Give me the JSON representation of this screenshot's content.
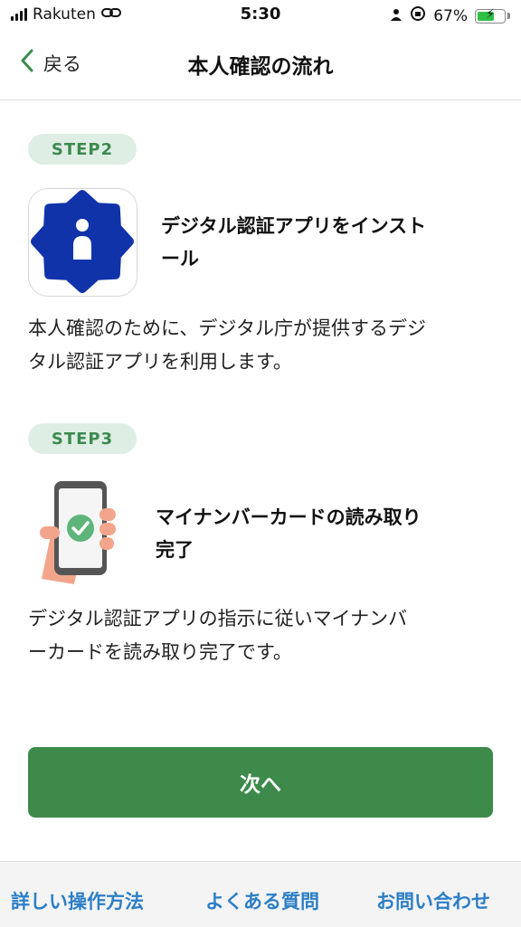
{
  "status_bar": {
    "carrier": "Rakuten",
    "time": "5:30",
    "battery": "67%",
    "battery_level": 0.67,
    "icons": [
      "signal-icon",
      "link-icon",
      "person-icon",
      "rotation-lock-icon",
      "battery-icon"
    ]
  },
  "nav": {
    "back_label": "戻る",
    "title": "本人確認の流れ"
  },
  "steps": [
    {
      "badge": "STEP2",
      "title_line1": "デジタル認証アプリをインスト",
      "title_line2": "ール",
      "desc_line1": "本人確認のために、デジタル庁が提供するデジ",
      "desc_line2": "タル認証アプリを利用します。",
      "icon": "digital-auth-app-icon"
    },
    {
      "badge": "STEP3",
      "title_line1": "マイナンバーカードの読み取り",
      "title_line2": "完了",
      "desc_line1": "デジタル認証アプリの指示に従いマイナンバ",
      "desc_line2": "ーカードを読み取り完了です。",
      "icon": "phone-check-icon"
    }
  ],
  "next_button": "次へ",
  "footer": {
    "links": [
      "詳しい操作方法",
      "よくある質問",
      "お問い合わせ"
    ]
  },
  "colors": {
    "accent_green": "#3d8a4b",
    "badge_bg": "#dfeee5",
    "badge_text": "#3b8a4e",
    "link_blue": "#2c7ec7",
    "app_icon_blue": "#1133aa"
  }
}
